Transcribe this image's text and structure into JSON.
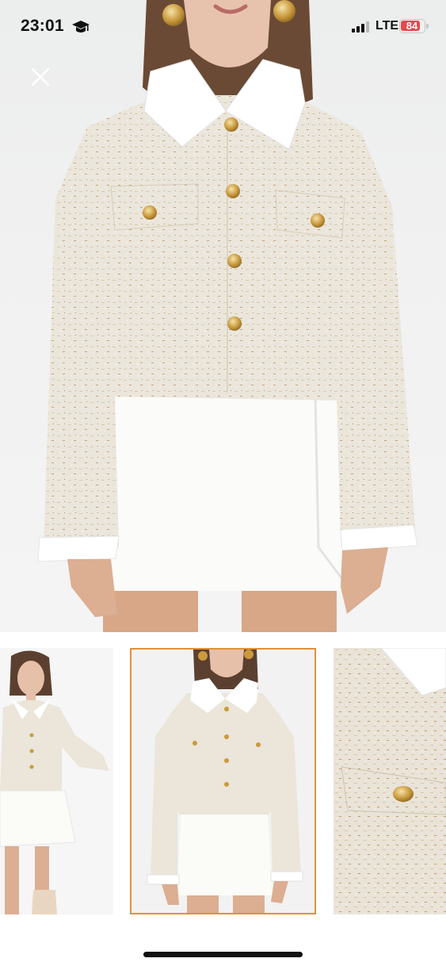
{
  "status_bar": {
    "time": "23:01",
    "network": "LTE",
    "battery": "84",
    "battery_level_percent": 84,
    "icons": [
      "graduation-cap-icon",
      "cellular-signal-icon",
      "battery-icon"
    ]
  },
  "toolbar": {
    "close_icon": "close-icon"
  },
  "gallery": {
    "selected_index": 1,
    "thumbnails": [
      {
        "id": "thumb-full-look"
      },
      {
        "id": "thumb-front-view",
        "selected": true
      },
      {
        "id": "thumb-detail-closeup"
      }
    ]
  },
  "colors": {
    "jacket_tweed": "#ebe5da",
    "thumbnail_selected_border": "#e0903a",
    "battery_low": "#e5484d"
  }
}
